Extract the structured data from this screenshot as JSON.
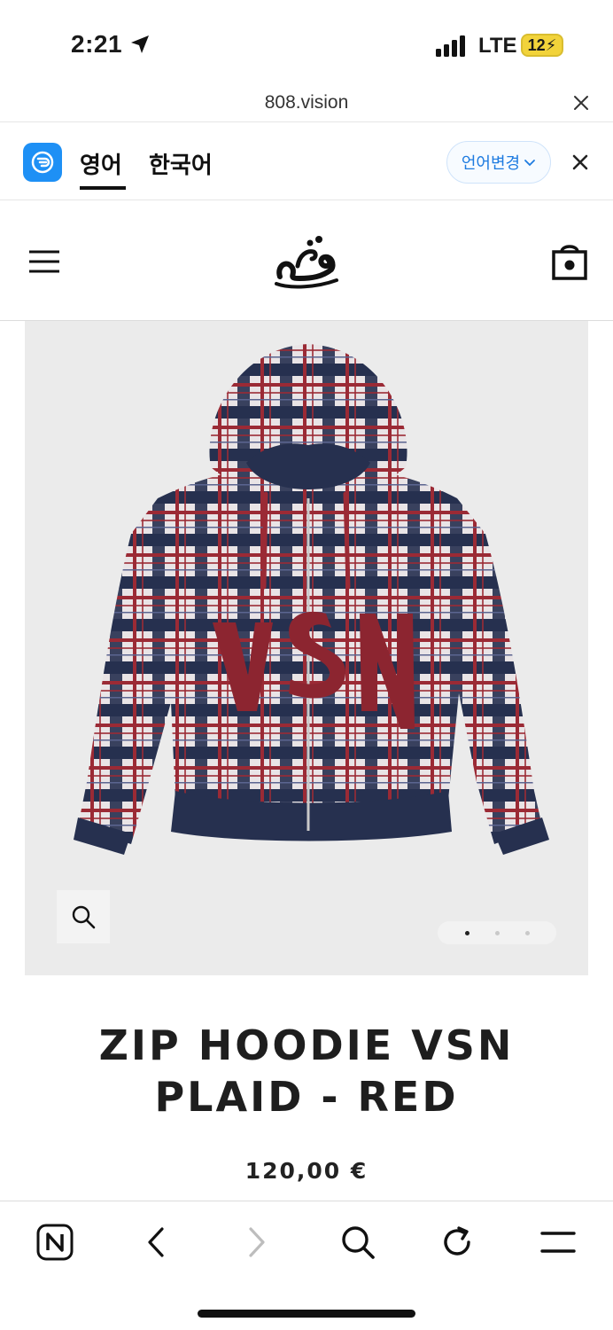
{
  "status_bar": {
    "time": "2:21",
    "network": "LTE",
    "battery": "12"
  },
  "url_bar": {
    "domain": "808.vision"
  },
  "translate_bar": {
    "tabs": [
      {
        "label": "영어",
        "active": true
      },
      {
        "label": "한국어",
        "active": false
      }
    ],
    "change_language_label": "언어변경",
    "accent_color": "#1e7be0",
    "logo_color": "#1e90f5"
  },
  "site_header": {
    "menu_icon": "hamburger-menu-icon",
    "logo_icon": "brand-logo",
    "cart_icon": "shopping-bag-icon"
  },
  "product": {
    "title": "ZIP HOODIE VSN PLAID - RED",
    "price": "120,00 €",
    "graphic_text": "VSN",
    "gallery_total": 3,
    "gallery_active_index": 0,
    "zoom_icon": "search-icon"
  },
  "toolbar": {
    "items": [
      {
        "name": "naver-home-icon",
        "label": "N"
      },
      {
        "name": "back-icon"
      },
      {
        "name": "forward-icon",
        "disabled": true
      },
      {
        "name": "search-icon"
      },
      {
        "name": "reload-icon"
      },
      {
        "name": "menu-icon"
      }
    ]
  }
}
